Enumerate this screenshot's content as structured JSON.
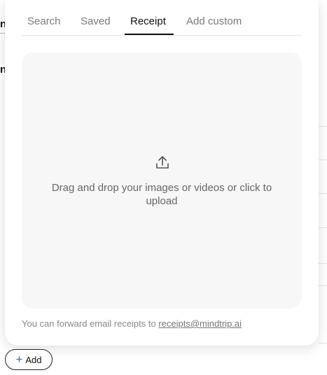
{
  "background": {
    "fragment_1": "n",
    "fragment_2": "n"
  },
  "tabs": [
    {
      "label": "Search",
      "active": false
    },
    {
      "label": "Saved",
      "active": false
    },
    {
      "label": "Receipt",
      "active": true
    },
    {
      "label": "Add custom",
      "active": false
    }
  ],
  "dropzone": {
    "icon": "upload-icon",
    "text": "Drag and drop your images or videos or click to upload"
  },
  "footer": {
    "prefix": "You can forward email receipts to ",
    "email": "receipts@mindtrip.ai"
  },
  "add_button": {
    "icon": "plus-icon",
    "label": "Add"
  },
  "colors": {
    "accent": "#1a6bd8",
    "text": "#111111",
    "muted": "#7a7a7a",
    "dropzone_bg": "#f7f7f7"
  }
}
